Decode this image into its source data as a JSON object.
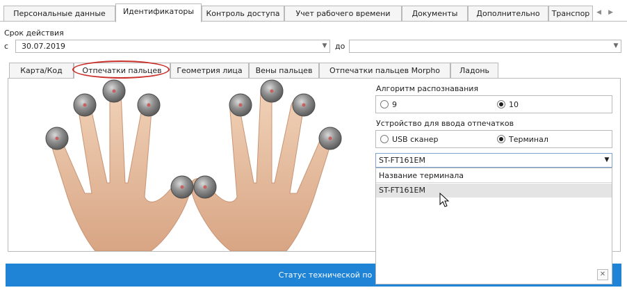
{
  "top_tabs": [
    "Персональные данные",
    "Идентификаторы",
    "Контроль доступа",
    "Учет рабочего времени",
    "Документы",
    "Дополнительно",
    "Транспор"
  ],
  "validity": {
    "title": "Срок действия",
    "from_label": "с",
    "from_value": "30.07.2019",
    "to_label": "до",
    "to_value": ""
  },
  "inner_tabs": [
    "Карта/Код",
    "Отпечатки пальцев",
    "Геометрия лица",
    "Вены пальцев",
    "Отпечатки пальцев Morpho",
    "Ладонь"
  ],
  "algorithm": {
    "label": "Алгоритм распознавания",
    "options": [
      "9",
      "10"
    ],
    "selected": "10"
  },
  "device": {
    "label": "Устройство для ввода отпечатков",
    "options": [
      "USB сканер",
      "Терминал"
    ],
    "selected": "Терминал"
  },
  "terminal_select": {
    "value": "ST-FT161EM",
    "list_header": "Название терминала",
    "items": [
      "ST-FT161EM"
    ]
  },
  "status_bar": "Статус технической по",
  "colors": {
    "accent": "#1f83d6",
    "highlight": "#c9302c",
    "skin": "#e6bea0"
  }
}
